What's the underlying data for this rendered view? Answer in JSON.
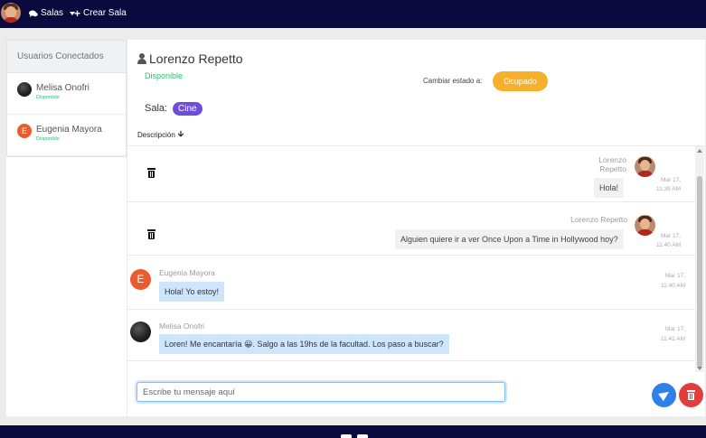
{
  "navbar": {
    "salas_label": "Salas",
    "crear_sala_label": "Crear Sala"
  },
  "sidebar": {
    "header": "Usuarios Conectados",
    "users": [
      {
        "name": "Melisa Onofri",
        "status": "Disponible",
        "avatar": "photo-dark"
      },
      {
        "name": "Eugenia Mayora",
        "status": "Disponible",
        "avatar_letter": "E"
      }
    ]
  },
  "room": {
    "user_name": "Lorenzo Repetto",
    "status": "Disponible",
    "change_status_label": "Cambiar estado a:",
    "change_status_button": "Ocupado",
    "sala_label": "Sala:",
    "sala_name": "Cine",
    "description_label": "Descripción"
  },
  "messages": [
    {
      "sender": "Lorenzo\nRepetto",
      "text": "Hola!",
      "date": "Mar 17,",
      "time": "11:39 AM",
      "own": true
    },
    {
      "sender": "Lorenzo Repetto",
      "text": "Alguien quiere ir a ver Once Upon a Time in Hollywood hoy?",
      "date": "Mar 17,",
      "time": "11:40 AM",
      "own": true
    },
    {
      "sender": "Eugenia Mayora",
      "text": "Hola! Yo estoy!",
      "date": "Mar 17,",
      "time": "11:40 AM",
      "own": false,
      "avatar_letter": "E"
    },
    {
      "sender": "Melisa Onofri",
      "text": "Loren! Me encantaría 😀. Salgo a las 19hs de la facultad. Los paso a buscar?",
      "date": "Mar 17,",
      "time": "11:41 AM",
      "own": false
    }
  ],
  "composer": {
    "placeholder": "Escribe tu mensaje aquí"
  },
  "colors": {
    "navbar": "#0b0a3e",
    "status_available": "#2fbf71",
    "busy_button": "#f7b02b",
    "sala_badge": "#6c4ed8",
    "send_button": "#2f80e8",
    "clear_button": "#e13d3d",
    "bubble_other": "#cde6fb"
  },
  "icons": {
    "salas": "comments-icon",
    "crear_sala": "plus-icon",
    "user": "person-icon",
    "delete": "trash-icon",
    "send": "paper-plane-icon"
  }
}
